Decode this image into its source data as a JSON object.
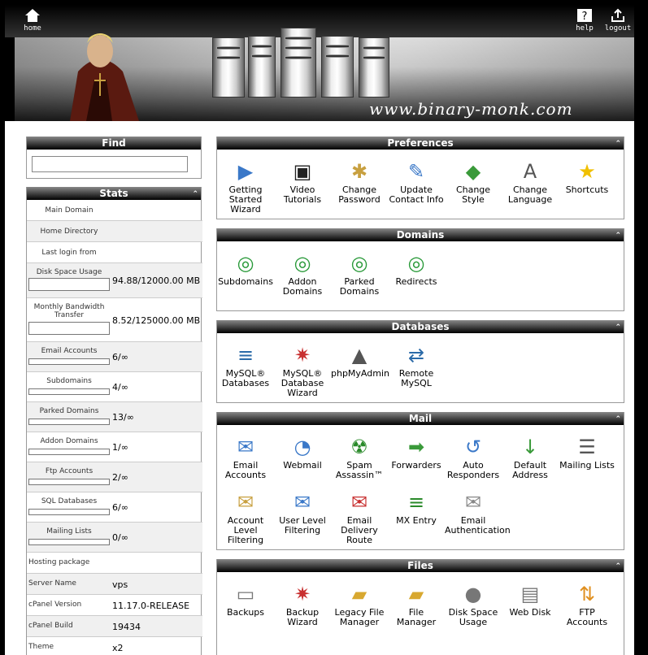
{
  "header": {
    "home_label": "home",
    "help_label": "help",
    "logout_label": "logout",
    "brand": "www.binary-monk.com"
  },
  "find": {
    "title": "Find"
  },
  "stats": {
    "title": "Stats",
    "rows": [
      {
        "label": "Main Domain",
        "value": ""
      },
      {
        "label": "Home Directory",
        "value": ""
      },
      {
        "label": "Last login from",
        "value": ""
      },
      {
        "label": "Disk Space Usage",
        "value": "94.88/12000.00 MB"
      },
      {
        "label": "Monthly Bandwidth Transfer",
        "value": "8.52/125000.00 MB"
      },
      {
        "label": "Email Accounts",
        "value": "6/∞"
      },
      {
        "label": "Subdomains",
        "value": "4/∞"
      },
      {
        "label": "Parked Domains",
        "value": "13/∞"
      },
      {
        "label": "Addon Domains",
        "value": "1/∞"
      },
      {
        "label": "Ftp Accounts",
        "value": "2/∞"
      },
      {
        "label": "SQL Databases",
        "value": "6/∞"
      },
      {
        "label": "Mailing Lists",
        "value": "0/∞"
      },
      {
        "label": "Hosting package",
        "value": ""
      },
      {
        "label": "Server Name",
        "value": "vps"
      },
      {
        "label": "cPanel Version",
        "value": "11.17.0-RELEASE"
      },
      {
        "label": "cPanel Build",
        "value": "19434"
      },
      {
        "label": "Theme",
        "value": "x2"
      }
    ]
  },
  "panels": {
    "preferences": {
      "title": "Preferences",
      "items": [
        {
          "label": "Getting Started Wizard",
          "icon": "wizard-icon"
        },
        {
          "label": "Video Tutorials",
          "icon": "clapperboard-icon"
        },
        {
          "label": "Change Password",
          "icon": "lock-icon"
        },
        {
          "label": "Update Contact Info",
          "icon": "contact-icon"
        },
        {
          "label": "Change Style",
          "icon": "palette-icon"
        },
        {
          "label": "Change Language",
          "icon": "language-icon"
        },
        {
          "label": "Shortcuts",
          "icon": "star-icon"
        }
      ]
    },
    "domains": {
      "title": "Domains",
      "items": [
        {
          "label": "Subdomains",
          "icon": "globe-icon"
        },
        {
          "label": "Addon Domains",
          "icon": "globe-icon"
        },
        {
          "label": "Parked Domains",
          "icon": "globe-icon"
        },
        {
          "label": "Redirects",
          "icon": "globe-icon"
        }
      ]
    },
    "databases": {
      "title": "Databases",
      "items": [
        {
          "label": "MySQL® Databases",
          "icon": "mysql-icon"
        },
        {
          "label": "MySQL® Database Wizard",
          "icon": "mysql-wizard-icon"
        },
        {
          "label": "phpMyAdmin",
          "icon": "phpmyadmin-icon"
        },
        {
          "label": "Remote MySQL",
          "icon": "remote-mysql-icon"
        }
      ]
    },
    "mail": {
      "title": "Mail",
      "items": [
        {
          "label": "Email Accounts",
          "icon": "envelope-icon"
        },
        {
          "label": "Webmail",
          "icon": "webmail-icon"
        },
        {
          "label": "Spam Assassin™",
          "icon": "spamassassin-icon"
        },
        {
          "label": "Forwarders",
          "icon": "forward-icon"
        },
        {
          "label": "Auto Responders",
          "icon": "autoresponder-icon"
        },
        {
          "label": "Default Address",
          "icon": "default-address-icon"
        },
        {
          "label": "Mailing Lists",
          "icon": "list-icon"
        },
        {
          "label": "Account Level Filtering",
          "icon": "filter-icon"
        },
        {
          "label": "User Level Filtering",
          "icon": "user-filter-icon"
        },
        {
          "label": "Email Delivery Route",
          "icon": "route-icon"
        },
        {
          "label": "MX Entry",
          "icon": "mx-icon"
        },
        {
          "label": "Email Authentication",
          "icon": "auth-icon"
        }
      ]
    },
    "files": {
      "title": "Files",
      "items": [
        {
          "label": "Backups",
          "icon": "backup-icon"
        },
        {
          "label": "Backup Wizard",
          "icon": "backup-wizard-icon"
        },
        {
          "label": "Legacy File Manager",
          "icon": "folder-icon"
        },
        {
          "label": "File Manager",
          "icon": "folder-icon"
        },
        {
          "label": "Disk Space Usage",
          "icon": "disk-icon"
        },
        {
          "label": "Web Disk",
          "icon": "webdisk-icon"
        },
        {
          "label": "FTP Accounts",
          "icon": "ftp-icon"
        }
      ]
    }
  }
}
